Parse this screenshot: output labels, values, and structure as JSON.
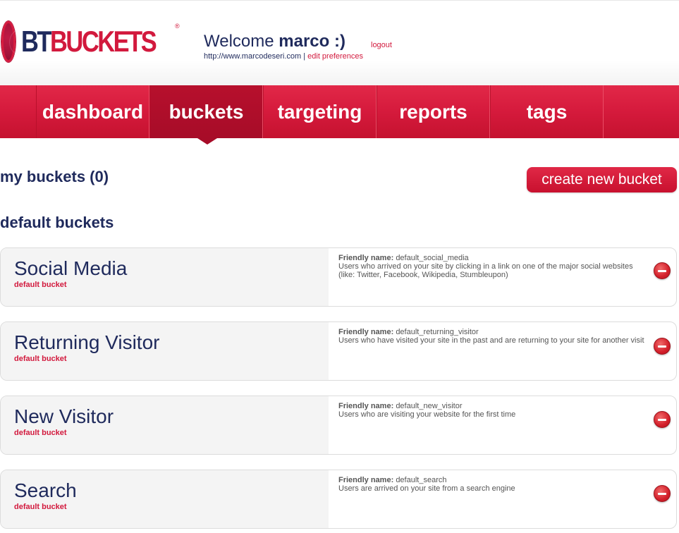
{
  "header": {
    "logo_text_left": "BT",
    "logo_text_right": "BUCKETS",
    "logo_reg": "®",
    "welcome_prefix": "Welcome",
    "username_text": "marco :)",
    "logout_label": "logout",
    "site_url": "http://www.marcodeseri.com",
    "separator": "|",
    "edit_preferences_label": "edit preferences"
  },
  "nav": {
    "items": [
      {
        "label": "dashboard"
      },
      {
        "label": "buckets"
      },
      {
        "label": "targeting"
      },
      {
        "label": "reports"
      },
      {
        "label": "tags"
      }
    ],
    "active": "buckets"
  },
  "main": {
    "my_buckets_heading": "my buckets (0)",
    "create_button_label": "create new bucket",
    "default_buckets_heading": "default buckets",
    "friendly_name_label": "Friendly name:",
    "buckets": [
      {
        "name": "Social Media",
        "type": "default bucket",
        "friendly_name": "default_social_media",
        "description": "Users who arrived on your site by clicking in a link on one of the major social websites (like: Twitter, Facebook, Wikipedia, Stumbleupon)"
      },
      {
        "name": "Returning Visitor",
        "type": "default bucket",
        "friendly_name": "default_returning_visitor",
        "description": "Users who have visited your site in the past and are returning to your site for another visit"
      },
      {
        "name": "New Visitor",
        "type": "default bucket",
        "friendly_name": "default_new_visitor",
        "description": "Users who are visiting your website for the first time"
      },
      {
        "name": "Search",
        "type": "default bucket",
        "friendly_name": "default_search",
        "description": "Users are arrived on your site from a search engine"
      }
    ]
  },
  "colors": {
    "brand_red": "#d2193d",
    "brand_navy": "#1f2a5c",
    "nav_active": "#a70c28"
  },
  "icons": {
    "remove": "remove-icon",
    "logo": "btbuckets-logo"
  }
}
